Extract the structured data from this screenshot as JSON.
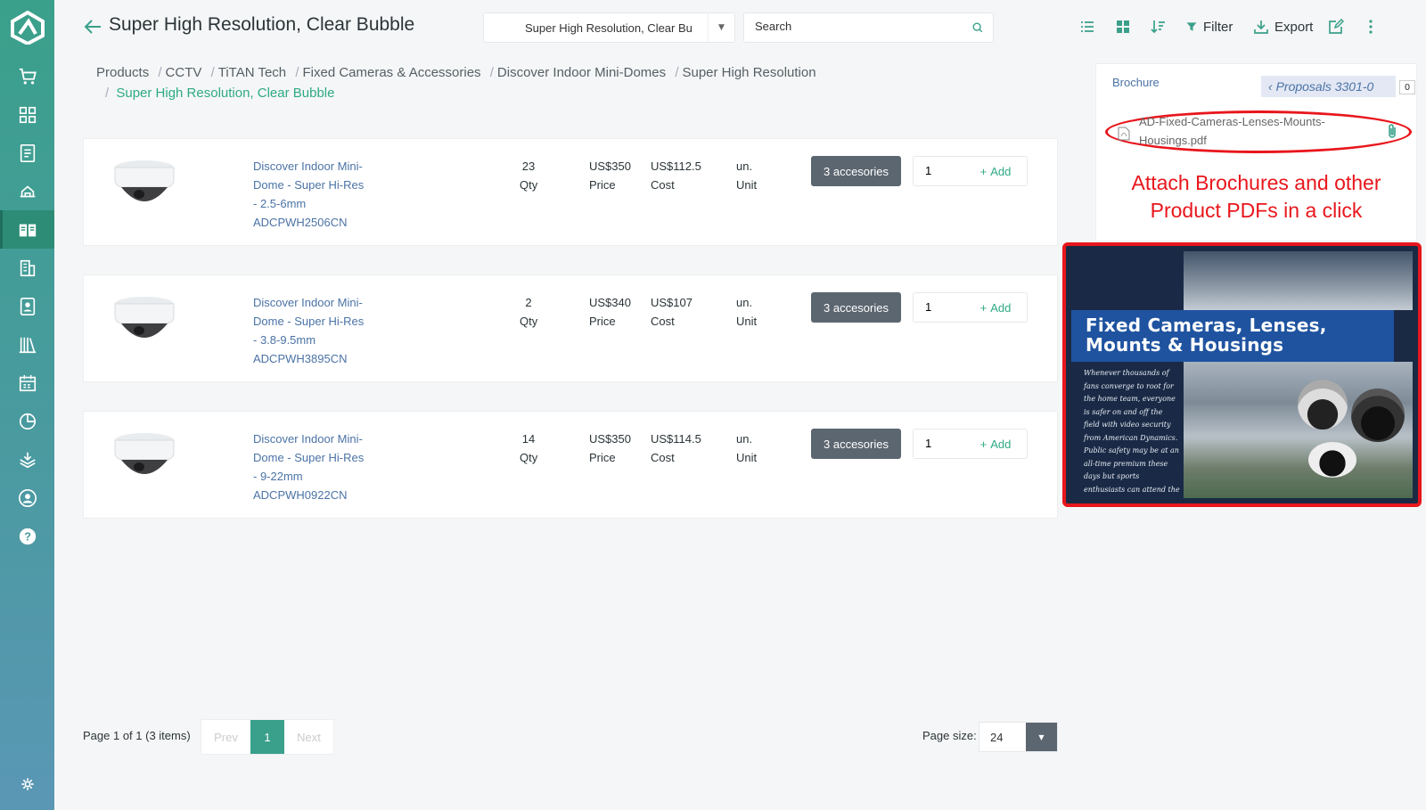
{
  "header": {
    "title": "Super High Resolution, Clear Bubble",
    "select_value": "Super High Resolution, Clear Bul",
    "search_placeholder": "Search",
    "filter_label": "Filter",
    "export_label": "Export"
  },
  "breadcrumb": {
    "items": [
      "Products",
      "CCTV",
      "TiTAN Tech",
      "Fixed Cameras & Accessories",
      "Discover Indoor Mini-Domes",
      "Super High Resolution"
    ],
    "current": "Super High Resolution, Clear Bubble"
  },
  "products": [
    {
      "name_lines": [
        "Discover Indoor Mini-",
        "Dome - Super Hi-Res",
        "- 2.5-6mm",
        "ADCPWH2506CN"
      ],
      "qty": "23",
      "qty_label": "Qty",
      "price": "US$350",
      "price_label": "Price",
      "cost": "US$112.5",
      "cost_label": "Cost",
      "unit": "un.",
      "unit_label": "Unit",
      "accessories": "3 accesories",
      "quantity_input": "1",
      "add_label": "Add"
    },
    {
      "name_lines": [
        "Discover Indoor Mini-",
        "Dome - Super Hi-Res",
        "- 3.8-9.5mm",
        "ADCPWH3895CN"
      ],
      "qty": "2",
      "qty_label": "Qty",
      "price": "US$340",
      "price_label": "Price",
      "cost": "US$107",
      "cost_label": "Cost",
      "unit": "un.",
      "unit_label": "Unit",
      "accessories": "3 accesories",
      "quantity_input": "1",
      "add_label": "Add"
    },
    {
      "name_lines": [
        "Discover Indoor Mini-",
        "Dome - Super Hi-Res",
        "- 9-22mm",
        "ADCPWH0922CN"
      ],
      "qty": "14",
      "qty_label": "Qty",
      "price": "US$350",
      "price_label": "Price",
      "cost": "US$114.5",
      "cost_label": "Cost",
      "unit": "un.",
      "unit_label": "Unit",
      "accessories": "3 accesories",
      "quantity_input": "1",
      "add_label": "Add"
    }
  ],
  "pagination": {
    "summary": "Page 1 of 1 (3 items)",
    "prev": "Prev",
    "current": "1",
    "next": "Next",
    "page_size_label": "Page size:",
    "page_size": "24"
  },
  "right_panel": {
    "heading": "Brochure",
    "proposal_tab": "Proposals 3301-0",
    "proposal_count": "0",
    "file_name": "AD-Fixed-Cameras-Lenses-Mounts-Housings.pdf",
    "annotation_line1": "Attach Brochures and other",
    "annotation_line2": "Product PDFs in a click"
  },
  "brochure": {
    "title_line1": "Fixed Cameras, Lenses,",
    "title_line2": "Mounts & Housings",
    "body_text": "Whenever thousands of fans converge to root for the home team, everyone is safer on and off the field with video security from American Dynamics. Public safety may be at an all-time premium these days but sports enthusiasts can attend the game secure in the knowledge that our fixed cameras never drop the ball."
  },
  "colors": {
    "accent": "#3aa08b",
    "link": "#4b73a6",
    "annotation_red": "#e8161c",
    "button_gray": "#5c6670"
  },
  "icons": {
    "sidebar": [
      "logo-icon",
      "cart-icon",
      "dashboard-icon",
      "document-icon",
      "tools-icon",
      "catalog-icon",
      "building-icon",
      "contact-icon",
      "library-icon",
      "calendar-icon",
      "chart-icon",
      "stack-icon",
      "user-icon",
      "help-icon",
      "settings-icon"
    ]
  }
}
